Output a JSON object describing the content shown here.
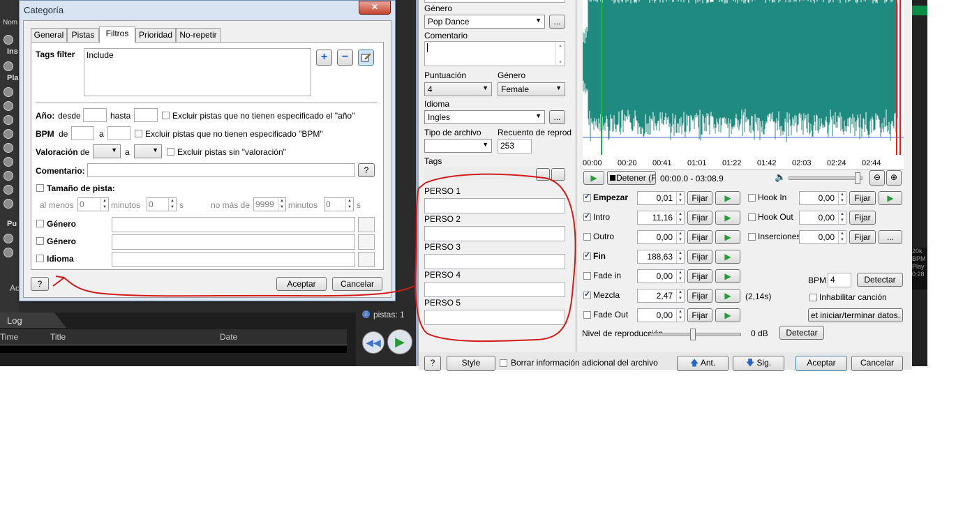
{
  "bg_app": {
    "title_fragment": "Ac",
    "side_items": [
      "Nom",
      "Ins",
      "Pla",
      "Pu"
    ],
    "log_tab": "Log",
    "log_columns": [
      "Time",
      "Title",
      "Date"
    ],
    "pistas_label": "pistas: 1",
    "bottom_left_fragment": "Ac",
    "right_fragments": [
      "20k",
      "BPM",
      "Play",
      "0:28"
    ]
  },
  "category_dialog": {
    "title": "Categoría",
    "close": "✕",
    "tabs": [
      "General",
      "Pistas",
      "Filtros",
      "Prioridad",
      "No-repetir"
    ],
    "active_tab": "Filtros",
    "tags_filter_label": "Tags filter",
    "tags_filter_value": "Include",
    "anio_label": "Año:",
    "desde": "desde",
    "hasta": "hasta",
    "excl_anio": "Excluir pistas que no tienen especificado el \"año\"",
    "bpm_label": "BPM",
    "de": "de",
    "a": "a",
    "excl_bpm": "Excluir pistas que no tienen especificado \"BPM\"",
    "valoracion_label": "Valoración",
    "excl_valoracion": "Excluir pistas sin \"valoración\"",
    "comentario_label": "Comentario:",
    "help": "?",
    "tamano_label": "Tamaño de  pista:",
    "al_menos": "al menos",
    "minutos": "minutos",
    "s": "s",
    "no_mas_de": "no más de",
    "zero": "0",
    "max_min": "9999",
    "genero1": "Género",
    "genero2": "Género",
    "idioma": "Idioma",
    "aceptar": "Aceptar",
    "cancelar": "Cancelar"
  },
  "info_panel": {
    "genero_label": "Género",
    "genero_value": "Pop Dance",
    "ellipsis": "...",
    "comentario_label": "Comentario",
    "puntuacion_label": "Puntuación",
    "puntuacion_value": "4",
    "genero2_label": "Género",
    "genero2_value": "Female",
    "idioma_label": "Idioma",
    "idioma_value": "Ingles",
    "tipo_label": "Tipo de archivo",
    "recuento_label": "Recuento de reprod",
    "recuento_value": "253",
    "tags_label": "Tags",
    "perso": [
      "PERSO 1",
      "PERSO 2",
      "PERSO 3",
      "PERSO 4",
      "PERSO 5"
    ]
  },
  "player": {
    "timeline": [
      "00:00",
      "00:20",
      "00:41",
      "01:01",
      "01:22",
      "01:42",
      "02:03",
      "02:24",
      "02:44"
    ],
    "stop_label": "Detener (F5",
    "position": "00:00.0 - 03:08.9",
    "wave_color": "#1f8a80",
    "cue_rows_left": [
      {
        "label": "Empezar",
        "checked": true,
        "bold": true,
        "value": "0,01"
      },
      {
        "label": "Intro",
        "checked": true,
        "bold": false,
        "value": "11,16"
      },
      {
        "label": "Outro",
        "checked": false,
        "bold": false,
        "value": "0,00"
      },
      {
        "label": "Fin",
        "checked": true,
        "bold": true,
        "value": "188,63"
      },
      {
        "label": "Fade in",
        "checked": false,
        "bold": false,
        "value": "0,00"
      },
      {
        "label": "Mezcla",
        "checked": true,
        "bold": false,
        "value": "2,47"
      },
      {
        "label": "Fade Out",
        "checked": false,
        "bold": false,
        "value": "0,00"
      }
    ],
    "fijar": "Fijar",
    "mezcla_extra": "(2,14s)",
    "cue_rows_right": [
      {
        "label": "Hook In",
        "value": "0,00"
      },
      {
        "label": "Hook Out",
        "value": "0,00"
      },
      {
        "label": "Inserciones",
        "value": "0,00"
      }
    ],
    "bpm_label": "BPM",
    "bpm_value": "4",
    "detectar": "Detectar",
    "inhabilitar": "Inhabilitar canción",
    "set_datos": "et iniciar/terminar datos.",
    "nivel_label": "Nivel de reproducción",
    "nivel_value": "0 dB",
    "detectar2": "Detectar"
  },
  "bottom_bar": {
    "help": "?",
    "style": "Style",
    "borrar": "Borrar información adicional del archivo",
    "ant": "Ant.",
    "sig": "Sig.",
    "aceptar": "Aceptar",
    "cancelar": "Cancelar"
  }
}
